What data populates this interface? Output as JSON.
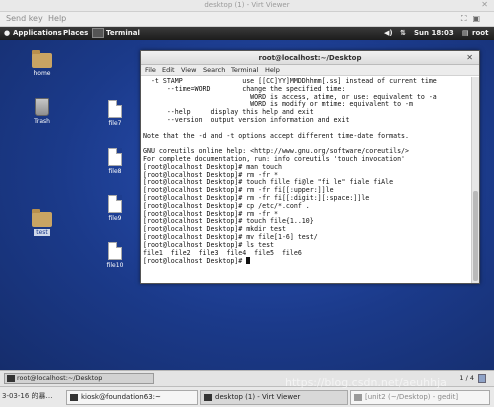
{
  "window": {
    "title": "desktop (1) - Virt Viewer",
    "close_glyph": "✕"
  },
  "menubar": {
    "items": [
      "Send key",
      "Help"
    ]
  },
  "guest_panel": {
    "applications": "Applications",
    "places": "Places",
    "terminal": "Terminal",
    "volume_icon": "volume-icon",
    "clock": "Sun 18:03",
    "user": "root"
  },
  "desktop_icons": [
    {
      "label": "home",
      "icon": "folder-icon"
    },
    {
      "label": "Trash",
      "icon": "trash-icon"
    },
    {
      "label": "file7",
      "icon": "file-icon"
    },
    {
      "label": "file8",
      "icon": "file-icon"
    },
    {
      "label": "test",
      "icon": "folder-icon",
      "selected": true
    },
    {
      "label": "file9",
      "icon": "file-icon"
    },
    {
      "label": "file10",
      "icon": "file-icon"
    }
  ],
  "terminal": {
    "title": "root@localhost:~/Desktop",
    "menu": [
      "File",
      "Edit",
      "View",
      "Search",
      "Terminal",
      "Help"
    ],
    "lines": [
      "  -t STAMP               use [[CC]YY]MMDDhhmm[.ss] instead of current time",
      "      --time=WORD        change the specified time:",
      "                           WORD is access, atime, or use: equivalent to -a",
      "                           WORD is modify or mtime: equivalent to -m",
      "      --help     display this help and exit",
      "      --version  output version information and exit",
      "",
      "Note that the -d and -t options accept different time-date formats.",
      "",
      "GNU coreutils online help: <http://www.gnu.org/software/coreutils/>",
      "For complete documentation, run: info coreutils 'touch invocation'",
      "[root@localhost Desktop]# man touch",
      "[root@localhost Desktop]# rm -fr *",
      "[root@localhost Desktop]# touch fille fi@le \"fi le\" fiale fiAle",
      "[root@localhost Desktop]# rm -fr fi[[:upper:]]le",
      "[root@localhost Desktop]# rm -fr fi[[:digit:][:space:]]le",
      "[root@localhost Desktop]# cp /etc/*.conf .",
      "[root@localhost Desktop]# rm -fr *",
      "[root@localhost Desktop]# touch file{1..10}",
      "[root@localhost Desktop]# mkdir test",
      "[root@localhost Desktop]# mv file[1-6] test/",
      "[root@localhost Desktop]# ls test",
      "file1  file2  file3  file4  file5  file6"
    ],
    "prompt": "[root@localhost Desktop]# "
  },
  "guest_bottom": {
    "task": "root@localhost:~/Desktop",
    "pager": "1 / 4"
  },
  "host_taskbar": {
    "clock": "3-03-16 的暴…",
    "items": [
      {
        "label": "kiosk@foundation63:~"
      },
      {
        "label": "desktop (1) - Virt Viewer"
      },
      {
        "label": "[unit2 (~/Desktop) - gedit]"
      }
    ]
  },
  "watermark": "https://blog.csdn.net/aeuhhja"
}
